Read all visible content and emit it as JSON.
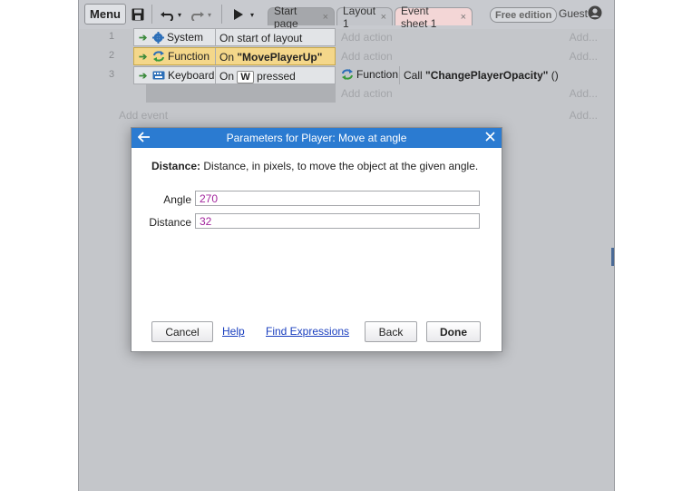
{
  "toolbar": {
    "menu_label": "Menu",
    "tabs": [
      {
        "label": "Start page"
      },
      {
        "label": "Layout 1"
      },
      {
        "label": "Event sheet 1"
      }
    ],
    "tab_close_glyph": "×",
    "edition_badge": "Free edition",
    "user_label": "Guest"
  },
  "events": [
    {
      "number": "1",
      "object": "System",
      "object_icon": "gear-icon",
      "condition": "On start of layout",
      "actions": [],
      "add_action": "Add action",
      "add_link": "Add..."
    },
    {
      "number": "2",
      "object": "Function",
      "object_icon": "function-icon",
      "condition_prefix": "On ",
      "condition_bold": "\"MovePlayerUp\"",
      "actions": [],
      "add_action": "Add action",
      "add_link": "Add..."
    },
    {
      "number": "3",
      "object": "Keyboard",
      "object_icon": "keyboard-icon",
      "condition_prefix": "On",
      "condition_key": "W",
      "condition_suffix": "pressed",
      "actions": [
        {
          "object": "Function",
          "text_prefix": "Call ",
          "text_bold": "\"ChangePlayerOpacity\"",
          "text_suffix": " ()"
        }
      ],
      "add_action": "Add action",
      "add_link": "Add..."
    }
  ],
  "add_event": "Add event",
  "add_event_link": "Add...",
  "dialog": {
    "title": "Parameters for Player: Move at angle",
    "description_label": "Distance:",
    "description_text": " Distance, in pixels, to move the object at the given angle.",
    "params": [
      {
        "label": "Angle",
        "value": "270"
      },
      {
        "label": "Distance",
        "value": "32"
      }
    ],
    "buttons": {
      "cancel": "Cancel",
      "help": "Help",
      "find_expressions": "Find Expressions",
      "back": "Back",
      "done": "Done"
    }
  },
  "colors": {
    "dialog_title_bg": "#2b7bd1",
    "parameter_text": "#a2249d",
    "function_highlight": "#f4d78a",
    "event_tab_bg": "#f3d6d6"
  }
}
